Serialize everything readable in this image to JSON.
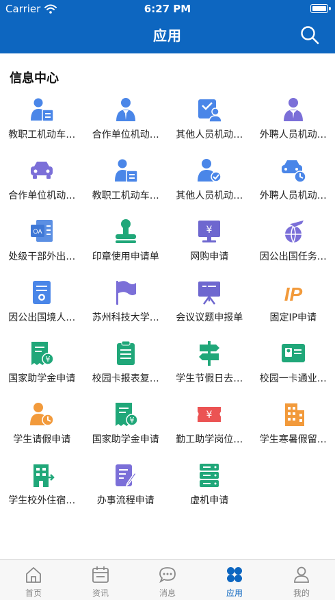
{
  "status_bar": {
    "carrier": "Carrier",
    "time": "6:27 PM"
  },
  "header": {
    "title": "应用"
  },
  "section": {
    "title": "信息中心"
  },
  "apps": [
    {
      "label": "教职工机动车…",
      "icon": "id-card-person-icon"
    },
    {
      "label": "合作单位机动…",
      "icon": "suit-person-icon"
    },
    {
      "label": "其他人员机动…",
      "icon": "clipboard-person-icon"
    },
    {
      "label": "外聘人员机动…",
      "icon": "suit-tie-person-icon"
    },
    {
      "label": "合作单位机动…",
      "icon": "car-icon"
    },
    {
      "label": "教职工机动车…",
      "icon": "id-card-person-icon"
    },
    {
      "label": "其他人员机动…",
      "icon": "person-check-icon"
    },
    {
      "label": "外聘人员机动…",
      "icon": "car-clock-icon"
    },
    {
      "label": "处级干部外出…",
      "icon": "oa-document-icon"
    },
    {
      "label": "印章使用申请单",
      "icon": "stamp-icon"
    },
    {
      "label": "网购申请",
      "icon": "monitor-yen-icon"
    },
    {
      "label": "因公出国任务…",
      "icon": "plane-globe-icon"
    },
    {
      "label": "因公出国境人…",
      "icon": "certificate-icon"
    },
    {
      "label": "苏州科技大学…",
      "icon": "flag-icon"
    },
    {
      "label": "会议议题申报单",
      "icon": "presentation-icon"
    },
    {
      "label": "固定IP申请",
      "icon": "ip-icon"
    },
    {
      "label": "国家助学金申请",
      "icon": "receipt-yen-icon"
    },
    {
      "label": "校园卡报表复…",
      "icon": "clipboard-list-icon"
    },
    {
      "label": "学生节假日去…",
      "icon": "signpost-icon"
    },
    {
      "label": "校园一卡通业…",
      "icon": "id-card-icon"
    },
    {
      "label": "学生请假申请",
      "icon": "person-clock-icon"
    },
    {
      "label": "国家助学金申请",
      "icon": "receipt-yen-icon"
    },
    {
      "label": "勤工助学岗位…",
      "icon": "ticket-yen-icon"
    },
    {
      "label": "学生寒暑假留…",
      "icon": "building-icon"
    },
    {
      "label": "学生校外住宿…",
      "icon": "building-arrow-icon"
    },
    {
      "label": "办事流程申请",
      "icon": "edit-document-icon"
    },
    {
      "label": "虚机申请",
      "icon": "server-icon"
    }
  ],
  "tabs": [
    {
      "label": "首页",
      "icon": "home-icon",
      "active": false
    },
    {
      "label": "资讯",
      "icon": "calendar-icon",
      "active": false
    },
    {
      "label": "消息",
      "icon": "chat-icon",
      "active": false
    },
    {
      "label": "应用",
      "icon": "grid-apps-icon",
      "active": true
    },
    {
      "label": "我的",
      "icon": "user-icon",
      "active": false
    }
  ],
  "colors": {
    "header": "#0d66c0",
    "accent": "#0d66c0",
    "tab_inactive": "#888888"
  }
}
